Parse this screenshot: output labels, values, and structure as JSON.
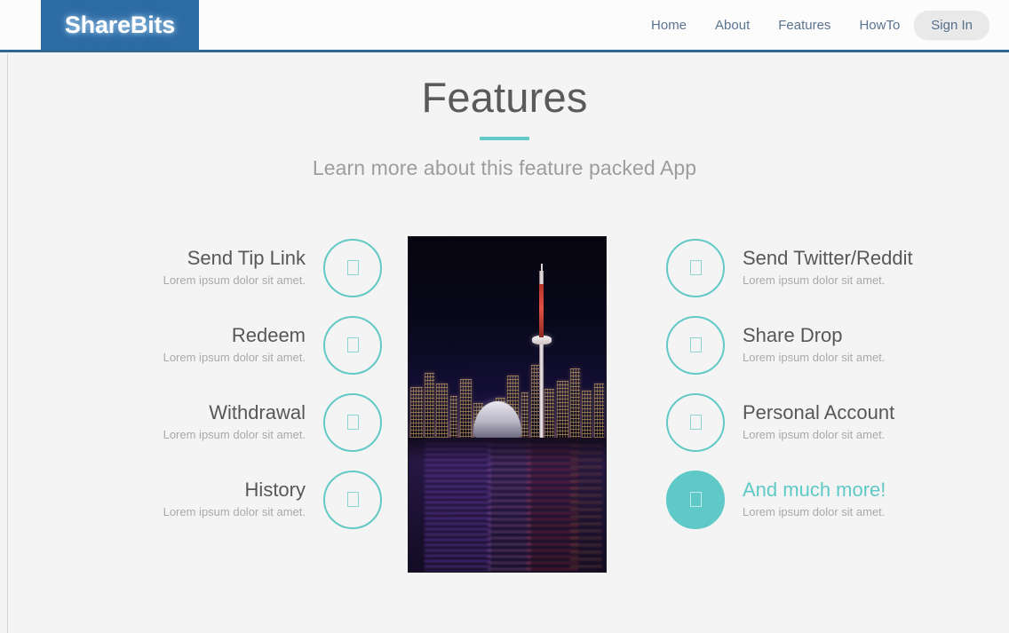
{
  "header": {
    "logo_text": "ShareBits",
    "nav_items": [
      {
        "label": "Home",
        "name": "nav-home"
      },
      {
        "label": "About",
        "name": "nav-about"
      },
      {
        "label": "Features",
        "name": "nav-features"
      },
      {
        "label": "HowTo",
        "name": "nav-howto"
      }
    ],
    "signin_label": "Sign In"
  },
  "hero": {
    "title": "Features",
    "subtitle": "Learn more about this feature packed App"
  },
  "features": {
    "left": [
      {
        "title": "Send Tip Link",
        "desc": "Lorem ipsum dolor sit amet.",
        "icon": "tofu-box-icon",
        "highlight": false
      },
      {
        "title": "Redeem",
        "desc": "Lorem ipsum dolor sit amet.",
        "icon": "tofu-box-icon",
        "highlight": false
      },
      {
        "title": "Withdrawal",
        "desc": "Lorem ipsum dolor sit amet.",
        "icon": "tofu-box-icon",
        "highlight": false
      },
      {
        "title": "History",
        "desc": "Lorem ipsum dolor sit amet.",
        "icon": "tofu-box-icon",
        "highlight": false
      }
    ],
    "right": [
      {
        "title": "Send Twitter/Reddit",
        "desc": "Lorem ipsum dolor sit amet.",
        "icon": "tofu-box-icon",
        "highlight": false
      },
      {
        "title": "Share Drop",
        "desc": "Lorem ipsum dolor sit amet.",
        "icon": "tofu-box-icon",
        "highlight": false
      },
      {
        "title": "Personal Account",
        "desc": "Lorem ipsum dolor sit amet.",
        "icon": "tofu-box-icon",
        "highlight": false
      },
      {
        "title": "And much more!",
        "desc": "Lorem ipsum dolor sit amet.",
        "icon": "tofu-box-icon",
        "highlight": true
      }
    ]
  },
  "media": {
    "photo_alt": "Toronto skyline at night with CN Tower reflected in water"
  },
  "colors": {
    "brand_blue": "#2d6ba3",
    "accent_teal": "#62c9c6",
    "heading_gray": "#5a5a5a",
    "body_gray": "#a9a9a9",
    "nav_link": "#5a7391",
    "page_bg": "#f4f4f4"
  }
}
